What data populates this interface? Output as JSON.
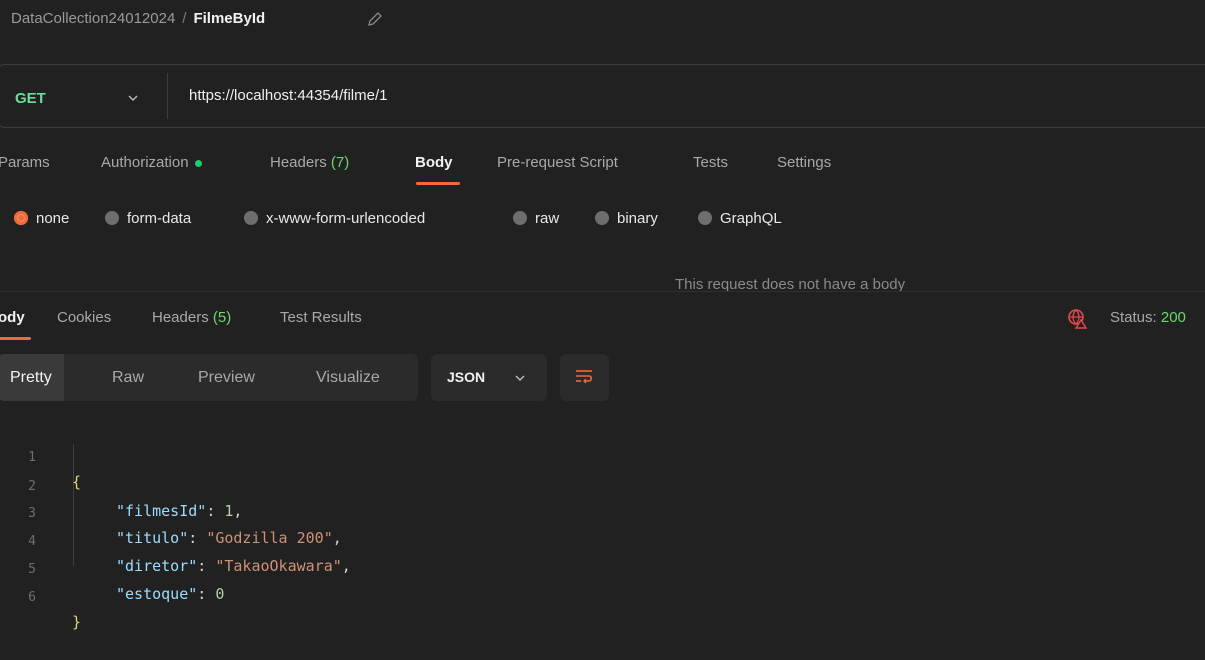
{
  "breadcrumb": {
    "parent": "DataCollection24012024",
    "separator": "/",
    "current": "FilmeById"
  },
  "request": {
    "method": "GET",
    "url": "https://localhost:44354/filme/1"
  },
  "request_tabs": [
    {
      "label": "Params"
    },
    {
      "label": "Authorization"
    },
    {
      "label": "Headers",
      "count": "(7)"
    },
    {
      "label": "Body"
    },
    {
      "label": "Pre-request Script"
    },
    {
      "label": "Tests"
    },
    {
      "label": "Settings"
    }
  ],
  "active_request_tab": "Body",
  "body_types": [
    "none",
    "form-data",
    "x-www-form-urlencoded",
    "raw",
    "binary",
    "GraphQL"
  ],
  "selected_body_type": "none",
  "empty_body_message": "This request does not have a body",
  "response_tabs": [
    {
      "label": "ody"
    },
    {
      "label": "Cookies"
    },
    {
      "label": "Headers",
      "count": "(5)"
    },
    {
      "label": "Test Results"
    }
  ],
  "status": {
    "label": "Status:",
    "value": "200"
  },
  "view_modes": [
    "Pretty",
    "Raw",
    "Preview",
    "Visualize"
  ],
  "active_view_mode": "Pretty",
  "format": "JSON",
  "code_lines": [
    {
      "n": "1",
      "brace": "{"
    },
    {
      "n": "2",
      "key": "\"filmesId\"",
      "value": "1",
      "vtype": "num",
      "comma": true
    },
    {
      "n": "3",
      "key": "\"titulo\"",
      "value": "\"Godzilla 200\"",
      "vtype": "str",
      "comma": true
    },
    {
      "n": "4",
      "key": "\"diretor\"",
      "value": "\"TakaoOkawara\"",
      "vtype": "str",
      "comma": true
    },
    {
      "n": "5",
      "key": "\"estoque\"",
      "value": "0",
      "vtype": "num",
      "comma": false
    },
    {
      "n": "6",
      "brace": "}"
    }
  ],
  "colors": {
    "accent": "#ef6a39",
    "method_get": "#6bdd9a",
    "count_green": "#6bd86b",
    "json_key": "#9cdcfe",
    "json_string": "#ce9178",
    "json_number": "#b5cea8"
  }
}
